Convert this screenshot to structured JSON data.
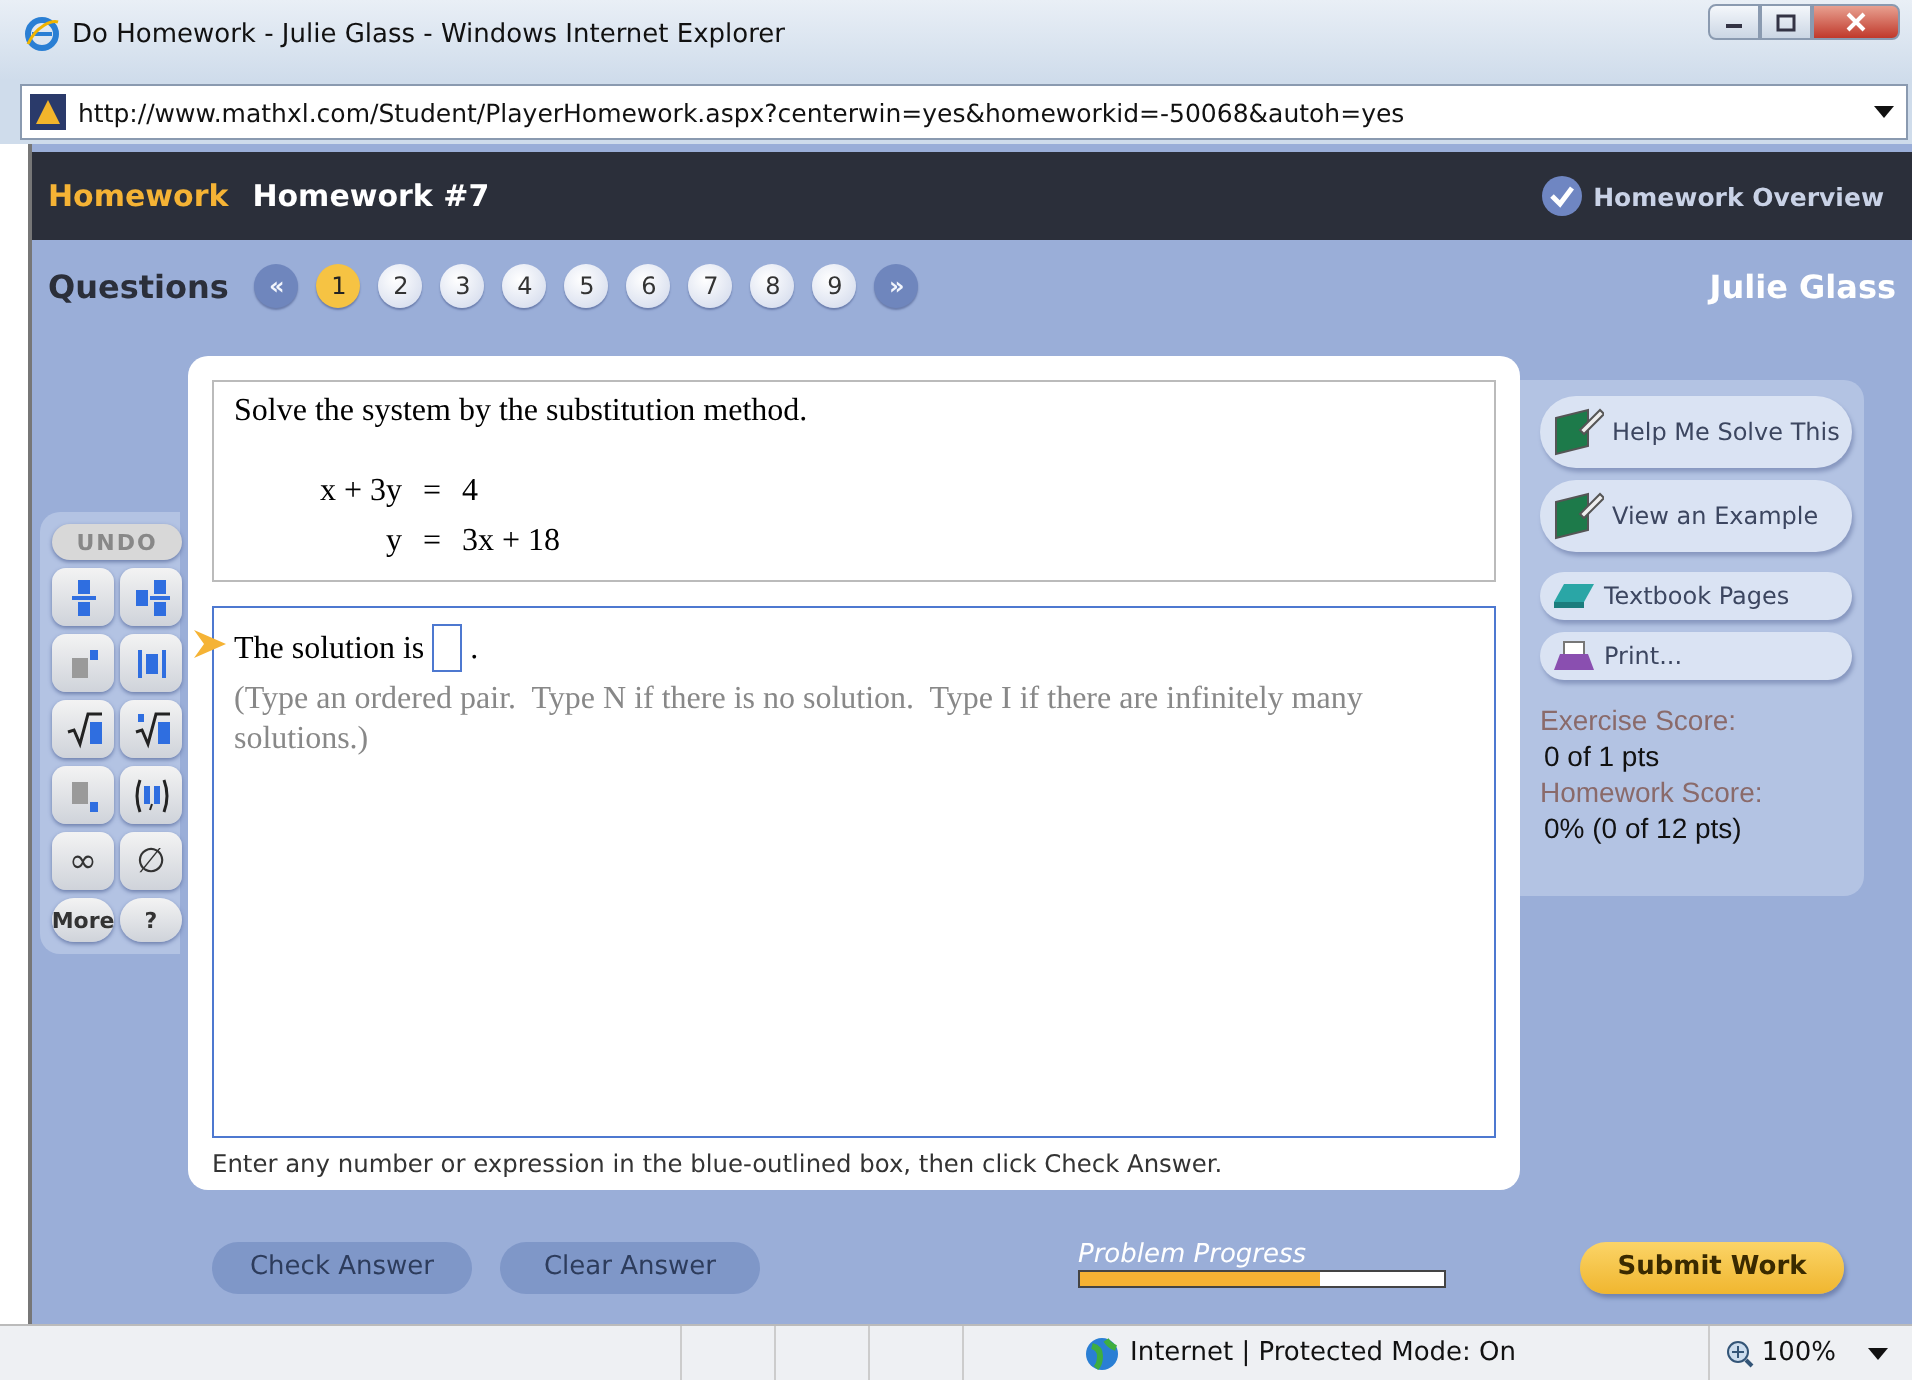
{
  "window": {
    "title": "Do Homework - Julie Glass - Windows Internet Explorer",
    "address": "http://www.mathxl.com/Student/PlayerHomework.aspx?centerwin=yes&homeworkid=-50068&autoh=yes"
  },
  "header": {
    "section": "Homework",
    "title": "Homework #7",
    "overview_link": "Homework Overview"
  },
  "questions": {
    "label": "Questions",
    "prev": "«",
    "next": "»",
    "student": "Julie Glass",
    "items": [
      {
        "label": "1",
        "selected": true
      },
      {
        "label": "2",
        "selected": false
      },
      {
        "label": "3",
        "selected": false
      },
      {
        "label": "4",
        "selected": false
      },
      {
        "label": "5",
        "selected": false
      },
      {
        "label": "6",
        "selected": false
      },
      {
        "label": "7",
        "selected": false
      },
      {
        "label": "8",
        "selected": false
      },
      {
        "label": "9",
        "selected": false
      }
    ]
  },
  "toolbox": {
    "undo": "UNDO",
    "more": "More",
    "help": "?",
    "buttons": [
      {
        "kind": "fraction"
      },
      {
        "kind": "mixed"
      },
      {
        "kind": "exponent"
      },
      {
        "kind": "abs"
      },
      {
        "kind": "sqrt"
      },
      {
        "kind": "nthroot"
      },
      {
        "kind": "subscript"
      },
      {
        "kind": "pair"
      },
      {
        "kind": "text",
        "label": "∞"
      },
      {
        "kind": "text",
        "label": "∅"
      }
    ]
  },
  "problem": {
    "instruction": "Solve the system by the substitution method.",
    "equations": [
      {
        "lhs": "x + 3y",
        "rel": "=",
        "rhs": "4"
      },
      {
        "lhs": "y",
        "rel": "=",
        "rhs": "3x + 18"
      }
    ],
    "answer_prefix": "The solution is",
    "answer_suffix": ".",
    "hint": "(Type an ordered pair.  Type N if there is no solution.  Type I if there are infinitely many solutions.)",
    "footer_note": "Enter any number or expression in the blue-outlined box, then click Check Answer."
  },
  "side_panel": {
    "buttons": [
      {
        "kind": "help",
        "label": "Help Me Solve This"
      },
      {
        "kind": "example",
        "label": "View an Example"
      },
      {
        "kind": "textbook",
        "label": "Textbook Pages"
      },
      {
        "kind": "print",
        "label": "Print..."
      }
    ],
    "scores": [
      {
        "label": "Exercise Score:",
        "value": "0 of 1 pts"
      },
      {
        "label": "Homework Score:",
        "value": "0% (0 of 12 pts)"
      }
    ]
  },
  "actions": {
    "check": "Check Answer",
    "clear": "Clear Answer",
    "progress_label": "Problem Progress",
    "progress": {
      "level": 0.66
    },
    "submit": "Submit Work"
  },
  "status_bar": {
    "zone": "Internet | Protected Mode: On",
    "zoom": "100%"
  }
}
